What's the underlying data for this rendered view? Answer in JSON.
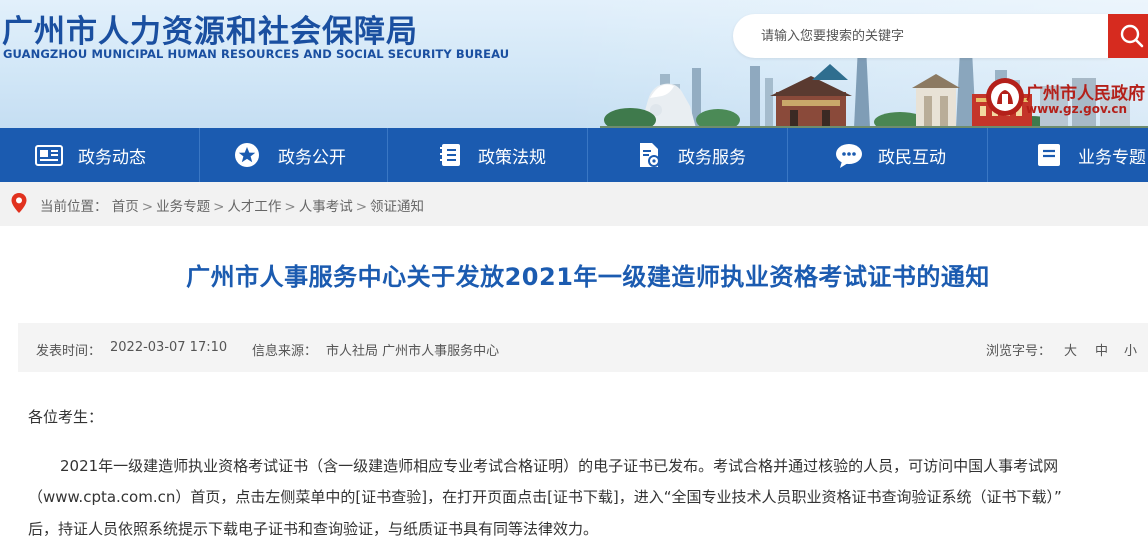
{
  "site": {
    "title": "广州市人力资源和社会保障局",
    "subtitle": "GUANGZHOU MUNICIPAL HUMAN RESOURCES AND SOCIAL SECURITY BUREAU"
  },
  "search": {
    "placeholder": "请输入您要搜索的关键字"
  },
  "gov_badge": {
    "name": "广州市人民政府",
    "url": "www.gz.gov.cn"
  },
  "nav": {
    "items": [
      {
        "label": "政务动态",
        "icon": "newspaper-icon"
      },
      {
        "label": "政务公开",
        "icon": "star-icon"
      },
      {
        "label": "政策法规",
        "icon": "book-icon"
      },
      {
        "label": "政务服务",
        "icon": "document-gear-icon"
      },
      {
        "label": "政民互动",
        "icon": "chat-icon"
      },
      {
        "label": "业务专题",
        "icon": "list-icon"
      }
    ]
  },
  "breadcrumb": {
    "prefix": "当前位置：",
    "items": [
      "首页",
      "业务专题",
      "人才工作",
      "人事考试",
      "领证通知"
    ],
    "separator": ">"
  },
  "article": {
    "title": "广州市人事服务中心关于发放2021年一级建造师执业资格考试证书的通知",
    "date_label": "发表时间：",
    "date": "2022-03-07 17:10",
    "source_label": "信息来源：",
    "source": "市人社局 广州市人事服务中心",
    "font_size_label": "浏览字号：",
    "font_sizes": [
      "大",
      "中",
      "小"
    ],
    "greeting": "各位考生：",
    "body_lines": [
      "2021年一级建造师执业资格考试证书（含一级建造师相应专业考试合格证明）的电子证书已发布。考试合格并通过核验的人员，可访问中国人事考试网",
      "（www.cpta.com.cn）首页，点击左侧菜单中的[证书查验]，在打开页面点击[证书下载]，进入“全国专业技术人员职业资格证书查询验证系统（证书下载）”",
      "后，持证人员依照系统提示下载电子证书和查询验证，与纸质证书具有同等法律效力。"
    ]
  },
  "colors": {
    "brand_blue": "#1b5bb0",
    "title_blue": "#1a4fa0",
    "search_red": "#d62b1f",
    "gov_red": "#b4201a"
  }
}
